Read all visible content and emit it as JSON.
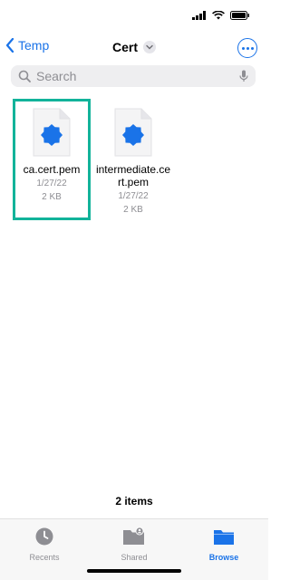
{
  "status": {
    "signal": "signal-icon",
    "wifi": "wifi-icon",
    "battery": "battery-icon"
  },
  "nav": {
    "back_label": "Temp",
    "title": "Cert"
  },
  "search": {
    "placeholder": "Search"
  },
  "files": [
    {
      "name": "ca.cert.pem",
      "date": "1/27/22",
      "size": "2 KB",
      "selected": true
    },
    {
      "name": "intermediate.cert.pem",
      "date": "1/27/22",
      "size": "2 KB",
      "selected": false
    }
  ],
  "footer": {
    "items_count": "2 items"
  },
  "tabs": [
    {
      "label": "Recents",
      "icon": "clock-icon",
      "active": false
    },
    {
      "label": "Shared",
      "icon": "shared-folder-icon",
      "active": false
    },
    {
      "label": "Browse",
      "icon": "folder-icon",
      "active": true
    }
  ],
  "colors": {
    "accent": "#1a73e8",
    "selection": "#12b39a",
    "cert_badge": "#1a73e8"
  }
}
